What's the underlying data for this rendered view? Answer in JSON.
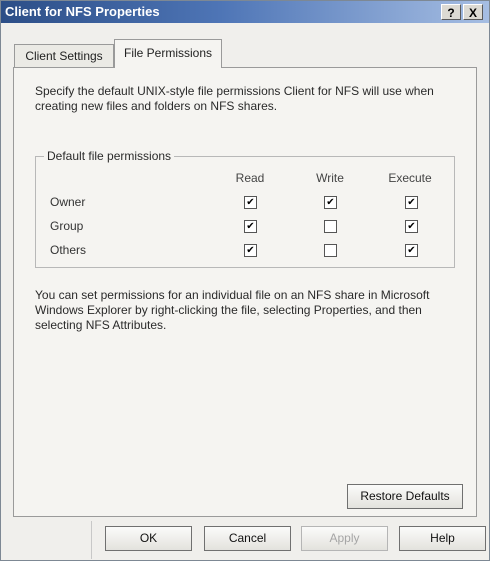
{
  "window": {
    "title": "Client for NFS Properties",
    "help_button": "?",
    "close_button": "X"
  },
  "tabs": [
    {
      "label": "Client Settings",
      "active": false
    },
    {
      "label": "File Permissions",
      "active": true
    }
  ],
  "panel": {
    "intro": "Specify the default UNIX-style file permissions Client for  NFS will use when creating new files and folders on NFS shares.",
    "groupbox_label": "Default file permissions",
    "columns": [
      "Read",
      "Write",
      "Execute"
    ],
    "rows": [
      {
        "label": "Owner",
        "read": true,
        "write": true,
        "execute": true
      },
      {
        "label": "Group",
        "read": true,
        "write": false,
        "execute": true
      },
      {
        "label": "Others",
        "read": true,
        "write": false,
        "execute": true
      }
    ],
    "note": "You can set permissions for an individual file on an NFS share in Microsoft Windows Explorer by right-clicking the file, selecting Properties, and then selecting NFS Attributes.",
    "restore_defaults_label": "Restore Defaults"
  },
  "buttons": {
    "ok": "OK",
    "cancel": "Cancel",
    "apply": "Apply",
    "help": "Help"
  }
}
